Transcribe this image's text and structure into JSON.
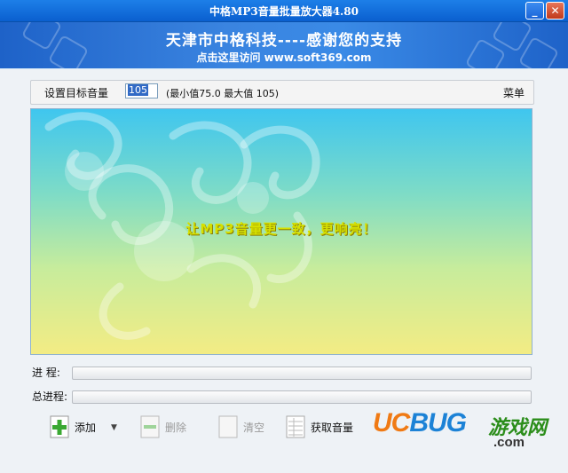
{
  "window": {
    "title": "中格MP3音量批量放大器4.80",
    "minimize_icon": "minimize-icon",
    "close_icon": "close-icon"
  },
  "banner": {
    "line1": "天津市中格科技----感谢您的支持",
    "line2": "点击这里访问 www.soft369.com"
  },
  "toolbar": {
    "label": "设置目标音量",
    "volume_value": "105",
    "range_text": "(最小值75.0  最大值 105)",
    "menu_label": "菜单"
  },
  "canvas": {
    "slogan": "让MP3音量更一致，更响亮！"
  },
  "progress": {
    "current_label": "进  程:",
    "current_value": 0,
    "total_label": "总进程:",
    "total_value": 0
  },
  "buttons": {
    "add": {
      "label": "添加",
      "icon": "plus-icon",
      "enabled": true
    },
    "delete": {
      "label": "删除",
      "icon": "minus-icon",
      "enabled": false
    },
    "clear": {
      "label": "清空",
      "icon": "clear-icon",
      "enabled": false
    },
    "get_volume": {
      "label": "获取音量",
      "icon": "table-icon",
      "enabled": true
    }
  },
  "watermark": {
    "uc": "UC",
    "bug": "BUG",
    "cn": "游戏网",
    "com": ".com"
  },
  "colors": {
    "title_bar": "#0a5fcf",
    "banner": "#2a72d8",
    "slogan": "#d6e000",
    "add_icon": "#3aa832"
  }
}
